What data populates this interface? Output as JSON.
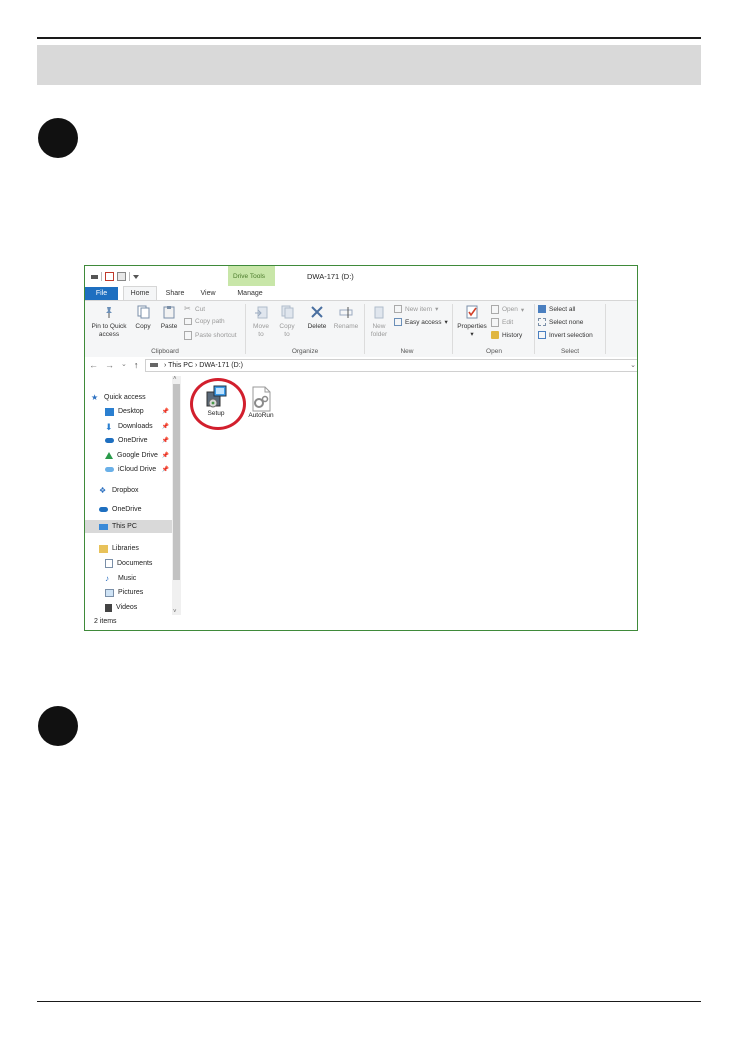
{
  "window": {
    "title": "DWA-171 (D:)",
    "context_group": "Drive Tools",
    "tabs": [
      "File",
      "Home",
      "Share",
      "View",
      "Manage"
    ]
  },
  "ribbon": {
    "clipboard": {
      "label": "Clipboard",
      "pin": "Pin to Quick access",
      "copy": "Copy",
      "paste": "Paste",
      "cut": "Cut",
      "copy_path": "Copy path",
      "paste_shortcut": "Paste shortcut"
    },
    "organize": {
      "label": "Organize",
      "move_to": "Move to",
      "copy_to": "Copy to",
      "delete": "Delete",
      "rename": "Rename"
    },
    "new": {
      "label": "New",
      "new_folder": "New folder",
      "new_item": "New item",
      "easy_access": "Easy access"
    },
    "open": {
      "label": "Open",
      "properties": "Properties",
      "open": "Open",
      "edit": "Edit",
      "history": "History"
    },
    "select": {
      "label": "Select",
      "select_all": "Select all",
      "select_none": "Select none",
      "invert": "Invert selection"
    }
  },
  "address": {
    "path": [
      "This PC",
      "DWA-171 (D:)"
    ]
  },
  "nav": {
    "quick_access": "Quick access",
    "pinned": [
      "Desktop",
      "Downloads",
      "OneDrive",
      "Google Drive",
      "iCloud Drive"
    ],
    "dropbox": "Dropbox",
    "onedrive": "OneDrive",
    "this_pc": "This PC",
    "libraries": "Libraries",
    "library_items": [
      "Documents",
      "Music",
      "Pictures",
      "Videos"
    ]
  },
  "files": [
    {
      "name": "Setup"
    },
    {
      "name": "AutoRun"
    }
  ],
  "status": "2 items",
  "colors": {
    "accent": "#1e6fc0",
    "context_tab": "#c8e6a8",
    "highlight_ring": "#d21f2d"
  }
}
